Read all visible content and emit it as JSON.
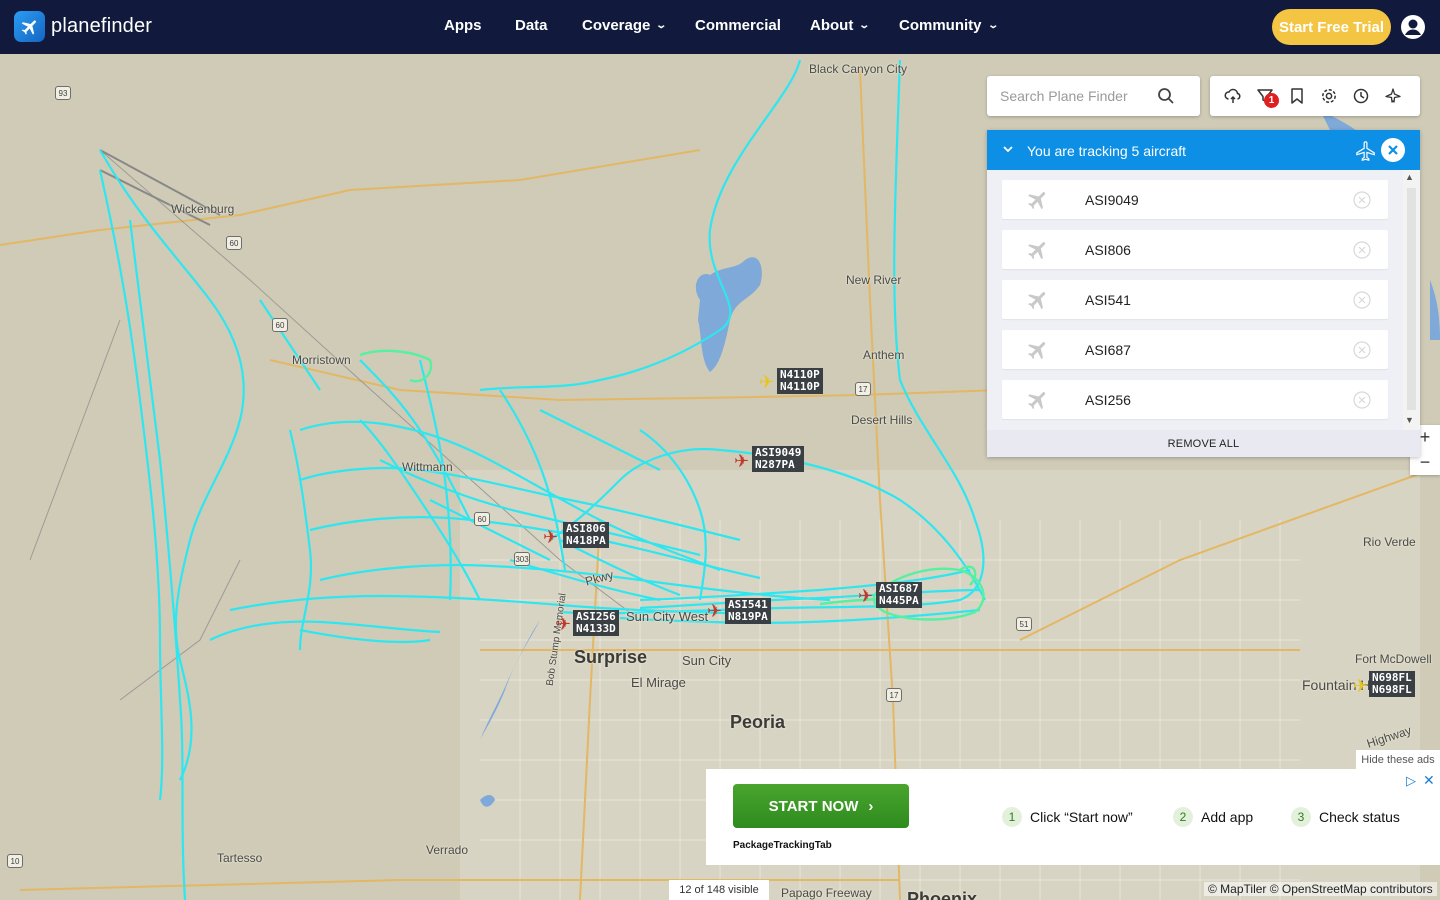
{
  "brand": {
    "name": "planefinder",
    "logo_icon": "plane-logo-icon"
  },
  "nav": {
    "items": [
      {
        "label": "Apps",
        "dropdown": false
      },
      {
        "label": "Data",
        "dropdown": false
      },
      {
        "label": "Coverage",
        "dropdown": true
      },
      {
        "label": "Commercial",
        "dropdown": false
      },
      {
        "label": "About",
        "dropdown": true
      },
      {
        "label": "Community",
        "dropdown": true
      }
    ],
    "cta_label": "Start Free Trial",
    "user_icon": "user-account-icon"
  },
  "search": {
    "placeholder": "Search Plane Finder",
    "value": ""
  },
  "toolbar": {
    "icons": [
      "weather-cloud-icon",
      "filter-icon",
      "bookmark-icon",
      "settings-gear-icon",
      "history-clock-icon",
      "plane-settings-icon"
    ],
    "filter_badge": "1"
  },
  "tracking": {
    "title": "You are tracking 5 aircraft",
    "aircraft": [
      {
        "callsign": "ASI9049"
      },
      {
        "callsign": "ASI806"
      },
      {
        "callsign": "ASI541"
      },
      {
        "callsign": "ASI687"
      },
      {
        "callsign": "ASI256"
      }
    ],
    "remove_all_label": "REMOVE ALL"
  },
  "zoom": {
    "in_label": "+",
    "out_label": "−"
  },
  "map": {
    "places": [
      {
        "name": "Black Canyon City",
        "size": "normal"
      },
      {
        "name": "Wickenburg",
        "size": "normal"
      },
      {
        "name": "New River",
        "size": "normal"
      },
      {
        "name": "Morristown",
        "size": "normal"
      },
      {
        "name": "Anthem",
        "size": "normal"
      },
      {
        "name": "Desert Hills",
        "size": "normal"
      },
      {
        "name": "Wittmann",
        "size": "normal"
      },
      {
        "name": "Rio Verde",
        "size": "normal"
      },
      {
        "name": "Fort McDowell",
        "size": "normal"
      },
      {
        "name": "Fountain Hills",
        "size": "big-ish"
      },
      {
        "name": "Surprise",
        "size": "big"
      },
      {
        "name": "Sun City",
        "size": "normal"
      },
      {
        "name": "Sun City West",
        "size": "normal"
      },
      {
        "name": "El Mirage",
        "size": "normal"
      },
      {
        "name": "Peoria",
        "size": "big"
      },
      {
        "name": "Tartesso",
        "size": "normal"
      },
      {
        "name": "Verrado",
        "size": "normal"
      },
      {
        "name": "Phoenix",
        "size": "big"
      },
      {
        "name": "Papago Freeway",
        "size": "normal"
      },
      {
        "name": "Highway",
        "size": "normal"
      },
      {
        "name": "Pkwy",
        "size": "normal"
      },
      {
        "name": "Bob Stump Memorial",
        "size": "normal"
      }
    ],
    "shields": [
      "93",
      "60",
      "60",
      "60",
      "17",
      "17",
      "51",
      "10",
      "303"
    ],
    "aircraft_labels": [
      {
        "line1": "N4110P",
        "line2": "N4110P",
        "color": "#e8c41e"
      },
      {
        "line1": "ASI9049",
        "line2": "N287PA",
        "color": "#c0392b"
      },
      {
        "line1": "ASI806",
        "line2": "N418PA",
        "color": "#c0392b"
      },
      {
        "line1": "ASI687",
        "line2": "N445PA",
        "color": "#c0392b"
      },
      {
        "line1": "ASI541",
        "line2": "N819PA",
        "color": "#c0392b"
      },
      {
        "line1": "ASI256",
        "line2": "N4133D",
        "color": "#c0392b"
      },
      {
        "line1": "N698FL",
        "line2": "N698FL",
        "color": "#e8c41e"
      }
    ],
    "colors": {
      "track": "#2ee6f0",
      "track_highlight": "#55f0a0",
      "water": "#7fa9d8",
      "land": "#cfcbb7",
      "road": "#e3b764"
    }
  },
  "ad": {
    "hide_label": "Hide these ads",
    "cta_label": "START NOW",
    "brand": "PackageTrackingTab",
    "steps": [
      {
        "num": "1",
        "text": "Click “Start now”"
      },
      {
        "num": "2",
        "text": "Add app"
      },
      {
        "num": "3",
        "text": "Check status"
      }
    ]
  },
  "footer": {
    "visible_count": "12 of 148 visible",
    "attribution": "© MapTiler © OpenStreetMap contributors"
  }
}
